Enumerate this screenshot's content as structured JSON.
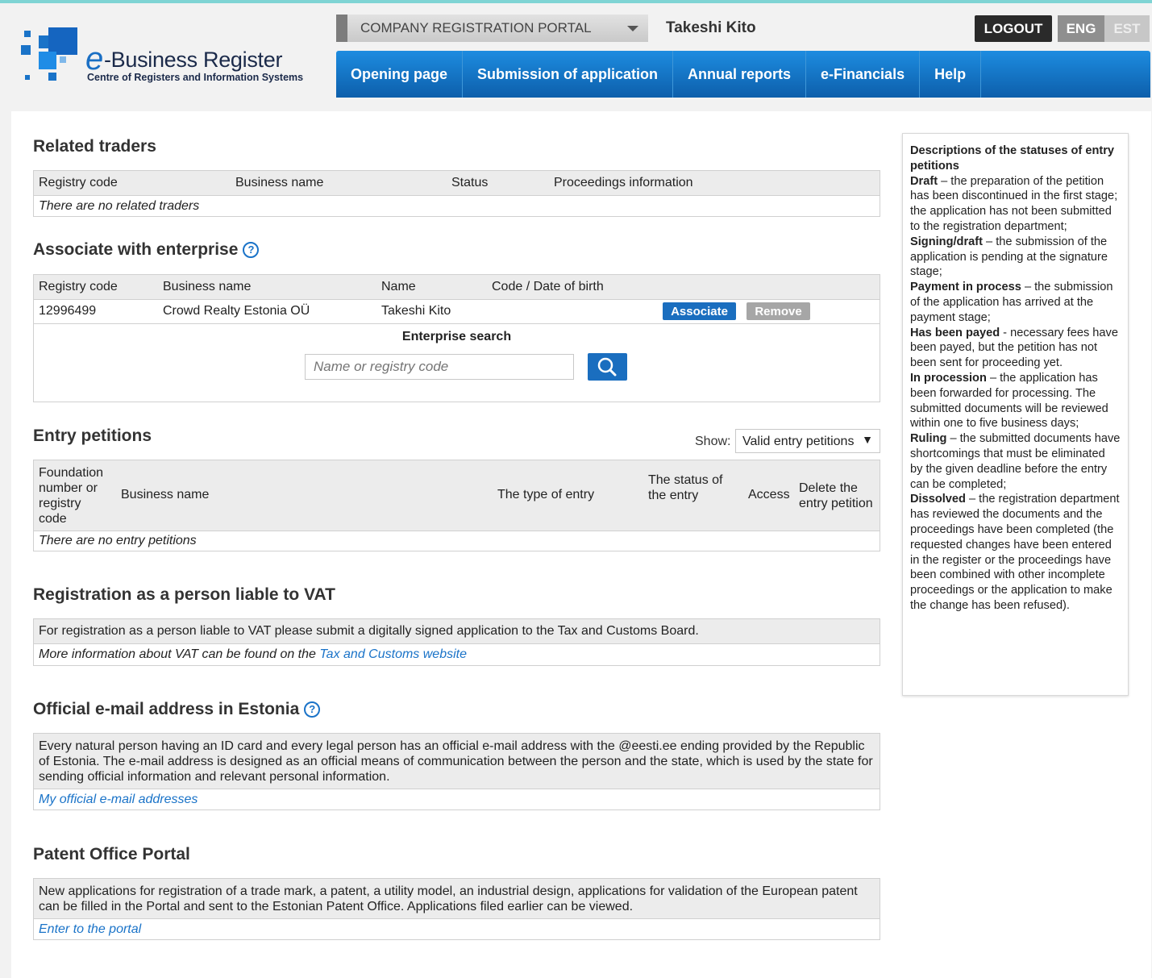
{
  "header": {
    "logo_letter": "e",
    "logo_title": "-Business Register",
    "logo_subtitle": "Centre of Registers and Information Systems",
    "portal": "COMPANY REGISTRATION PORTAL",
    "user": "Takeshi Kito",
    "logout": "LOGOUT",
    "lang_eng": "ENG",
    "lang_est": "EST"
  },
  "nav": [
    "Opening page",
    "Submission of application",
    "Annual reports",
    "e-Financials",
    "Help"
  ],
  "related_traders": {
    "title": "Related traders",
    "columns": [
      "Registry code",
      "Business name",
      "Status",
      "Proceedings information"
    ],
    "empty": "There are no related traders"
  },
  "associate": {
    "title": "Associate with enterprise",
    "columns": [
      "Registry code",
      "Business name",
      "Name",
      "Code / Date of birth"
    ],
    "row": {
      "code": "12996499",
      "business": "Crowd Realty Estonia OÜ",
      "name": "Takeshi Kito"
    },
    "associate_btn": "Associate",
    "remove_btn": "Remove",
    "search_title": "Enterprise search",
    "search_placeholder": "Name or registry code"
  },
  "entry_petitions": {
    "title": "Entry petitions",
    "show_label": "Show:",
    "show_value": "Valid entry petitions",
    "columns": [
      "Foundation number or registry code",
      "Business name",
      "The type of entry",
      "The status of the entry",
      "Access",
      "Delete the entry petition"
    ],
    "empty": "There are no entry petitions"
  },
  "vat": {
    "title": "Registration as a person liable to VAT",
    "text": "For registration as a person liable to VAT please submit a digitally signed application to the Tax and Customs Board.",
    "more_prefix": "More information about VAT can be found on the",
    "more_link": "Tax and Customs website"
  },
  "email": {
    "title": "Official e-mail address in Estonia",
    "text": "Every natural person having an ID card and every legal person has an official e-mail address with the @eesti.ee ending provided by the Republic of Estonia. The e-mail address is designed as an official means of communication between the person and the state, which is used by the state for sending official information and relevant personal information.",
    "link": "My official e-mail addresses"
  },
  "patent": {
    "title": "Patent Office Portal",
    "text": "New applications for registration of a trade mark, a patent, a utility model, an industrial design, applications for validation of the European patent can be filled in the Portal and sent to the Estonian Patent Office. Applications filed earlier can be viewed.",
    "link": "Enter to the portal"
  },
  "sidebar": {
    "title": "Descriptions of the statuses of entry petitions",
    "items": [
      {
        "term": "Draft",
        "desc": " – the preparation of the petition has been discontinued in the first stage; the application has not been submitted to the registration department;"
      },
      {
        "term": "Signing/draft",
        "desc": " – the submission of the application is pending at the signature stage;"
      },
      {
        "term": "Payment in process",
        "desc": " – the submission of the application has arrived at the payment stage;"
      },
      {
        "term": "Has been payed",
        "desc": " - necessary fees have been payed, but the petition has not been sent for proceeding yet."
      },
      {
        "term": "In procession",
        "desc": " – the application has been forwarded for processing. The submitted documents will be reviewed within one to five business days;"
      },
      {
        "term": "Ruling",
        "desc": " – the submitted documents have shortcomings that must be eliminated by the given deadline before the entry can be completed;"
      },
      {
        "term": "Dissolved",
        "desc": " – the registration department has reviewed the documents and the proceedings have been completed (the requested changes have been entered in the register or the proceedings have been combined with other incomplete proceedings or the application to make the change has been refused)."
      }
    ]
  },
  "colors": {
    "nav_blue": "#1a73c8",
    "button_blue": "#1a6ebf",
    "link": "#1a73c8"
  }
}
